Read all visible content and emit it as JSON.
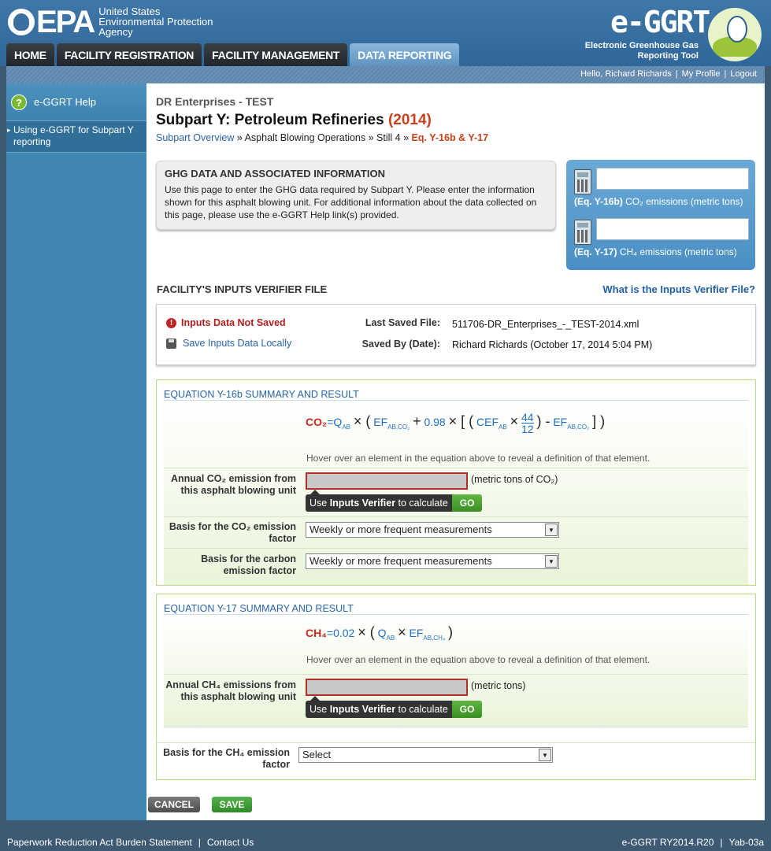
{
  "header": {
    "epa_text": "EPA",
    "agency_line1": "United States",
    "agency_line2": "Environmental Protection",
    "agency_line3": "Agency",
    "app_name": "e-GGRT",
    "app_sub1": "Electronic Greenhouse Gas",
    "app_sub2": "Reporting Tool"
  },
  "nav": {
    "tabs": [
      {
        "label": "HOME"
      },
      {
        "label": "FACILITY REGISTRATION"
      },
      {
        "label": "FACILITY MANAGEMENT"
      },
      {
        "label": "DATA REPORTING"
      }
    ]
  },
  "userbar": {
    "greeting": "Hello, Richard Richards",
    "profile": "My Profile",
    "logout": "Logout"
  },
  "sidebar": {
    "help_label": "e-GGRT Help",
    "link_label": "Using e-GGRT for Subpart Y reporting"
  },
  "page": {
    "org": "DR Enterprises - TEST",
    "title": "Subpart Y: Petroleum Refineries",
    "year": "(2014)",
    "crumbs": {
      "overview": "Subpart Overview",
      "op": "Asphalt Blowing Operations",
      "unit": "Still 4",
      "current": "Eq. Y-16b & Y-17"
    }
  },
  "ghg_box": {
    "title": "GHG DATA AND ASSOCIATED INFORMATION",
    "body": "Use this page to enter the GHG data required by Subpart Y. Please enter the information shown for this asphalt blowing unit. For additional information about the data collected on this page, please use the e-GGRT Help link(s) provided."
  },
  "calc_panel": {
    "row1_eq": "(Eq. Y-16b)",
    "row1_label": "CO₂ emissions (metric tons)",
    "row1_value": "",
    "row2_eq": "(Eq. Y-17)",
    "row2_label": "CH₄ emissions (metric tons)",
    "row2_value": ""
  },
  "verifier": {
    "heading": "FACILITY'S INPUTS VERIFIER FILE",
    "help_link": "What is the Inputs Verifier File?",
    "not_saved": "Inputs Data Not Saved",
    "save_local": "Save Inputs Data Locally",
    "last_saved_label": "Last Saved File:",
    "last_saved_value": "511706-DR_Enterprises_-_TEST-2014.xml",
    "saved_by_label": "Saved By (Date):",
    "saved_by_value": "Richard Richards (October 17, 2014 5:04 PM)"
  },
  "eq_y16b": {
    "title": "EQUATION Y-16b SUMMARY AND RESULT",
    "f_lhs": "CO₂",
    "f_q": "Q",
    "f_q_sub": "AB",
    "f_ef": "EF",
    "f_ef_sub": "AB,CO₂",
    "f_const": "0.98",
    "f_cef": "CEF",
    "f_cef_sub": "AB",
    "f_num": "44",
    "f_den": "12",
    "f_ef2": "EF",
    "f_ef2_sub": "AB,CO₂",
    "hover_note": "Hover over an element in the equation above to reveal a definition of that element.",
    "annual_label": "Annual CO₂ emission from this asphalt blowing unit",
    "annual_value": "",
    "annual_unit": "(metric tons of CO₂)",
    "verify_pre": "Use ",
    "verify_bold": "Inputs Verifier",
    "verify_post": " to calculate",
    "go": "GO",
    "basis_co2_label": "Basis for the CO₂ emission factor",
    "basis_co2_value": "Weekly or more frequent measurements",
    "basis_carbon_label": "Basis for the carbon emission factor",
    "basis_carbon_value": "Weekly or more frequent measurements"
  },
  "eq_y17": {
    "title": "EQUATION Y-17 SUMMARY AND RESULT",
    "f_lhs": "CH₄",
    "f_const": "0.02",
    "f_q": "Q",
    "f_q_sub": "AB",
    "f_ef": "EF",
    "f_ef_sub": "AB,CH₄",
    "hover_note": "Hover over an element in the equation above to reveal a definition of that element.",
    "annual_label": "Annual CH₄ emissions from this asphalt blowing unit",
    "annual_value": "",
    "annual_unit": "(metric tons)",
    "verify_pre": "Use ",
    "verify_bold": "Inputs Verifier",
    "verify_post": " to calculate",
    "go": "GO",
    "basis_ch4_label": "Basis for the CH₄ emission factor",
    "basis_ch4_value": "Select"
  },
  "actions": {
    "cancel": "CANCEL",
    "save": "SAVE"
  },
  "footer": {
    "paperwork": "Paperwork Reduction Act Burden Statement",
    "contact": "Contact Us",
    "version": "e-GGRT RY2014.R20",
    "screen_id": "Yab-03a"
  }
}
